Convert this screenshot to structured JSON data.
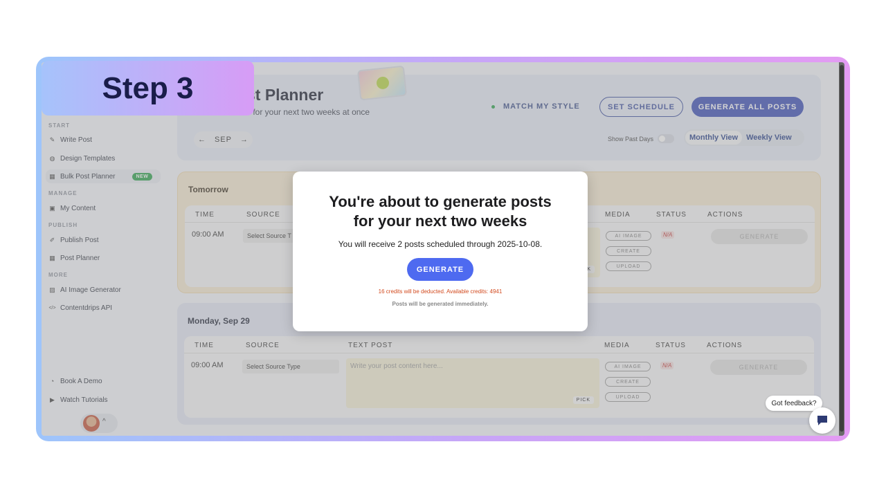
{
  "step_label": "Step 3",
  "sidebar": {
    "sections": {
      "start": "START",
      "manage": "MANAGE",
      "publish": "PUBLISH",
      "more": "MORE"
    },
    "items": [
      {
        "label": "Write Post",
        "icon": "magic-wand-icon"
      },
      {
        "label": "Design Templates",
        "icon": "palette-icon"
      },
      {
        "label": "Bulk Post Planner",
        "icon": "calendar-clock-icon",
        "badge": "NEW"
      },
      {
        "label": "My Content",
        "icon": "images-icon"
      },
      {
        "label": "Publish Post",
        "icon": "pen-icon"
      },
      {
        "label": "Post Planner",
        "icon": "calendar-icon"
      },
      {
        "label": "AI Image Generator",
        "icon": "image-icon"
      },
      {
        "label": "Contentdrips API",
        "icon": "code-icon"
      }
    ],
    "bottom": [
      {
        "label": "Book A Demo",
        "icon": "headset-icon"
      },
      {
        "label": "Watch Tutorials",
        "icon": "play-icon"
      }
    ]
  },
  "header": {
    "title": "st Planner",
    "subtitle": "s for your next two weeks at once",
    "match_style": "MATCH MY STYLE",
    "set_schedule": "SET SCHEDULE",
    "generate_all": "GENERATE ALL POSTS",
    "month": "SEP",
    "prev": "←",
    "next": "→",
    "show_past_days": "Show Past Days",
    "monthly_view": "Monthly View",
    "weekly_view": "Weekly View"
  },
  "table_headers": [
    "TIME",
    "SOURCE",
    "TEXT POST",
    "MEDIA",
    "STATUS",
    "ACTIONS"
  ],
  "days": [
    {
      "title": "Tomorrow",
      "time": "09:00 AM",
      "source": "Select Source T",
      "text_placeholder": "",
      "pick": "K",
      "media": [
        "AI IMAGE",
        "CREATE",
        "UPLOAD"
      ],
      "status": "N/A",
      "action": "GENERATE"
    },
    {
      "title": "Monday, Sep 29",
      "time": "09:00 AM",
      "source": "Select Source Type",
      "text_placeholder": "Write your post content here...",
      "pick": "PICK",
      "media": [
        "AI IMAGE",
        "CREATE",
        "UPLOAD"
      ],
      "status": "N/A",
      "action": "GENERATE"
    }
  ],
  "modal": {
    "title_line1": "You're about to generate posts",
    "title_line2": "for your next two weeks",
    "description": "You will receive 2 posts scheduled through 2025-10-08.",
    "button": "GENERATE",
    "credits": "16 credits will be deducted. Available credits: 4941",
    "note": "Posts will be generated immediately."
  },
  "feedback": "Got feedback?",
  "colors": {
    "primary": "#3d50b8",
    "modal_button": "#4e6af0",
    "credits_text": "#d24a1e",
    "new_badge": "#2ea44f"
  }
}
